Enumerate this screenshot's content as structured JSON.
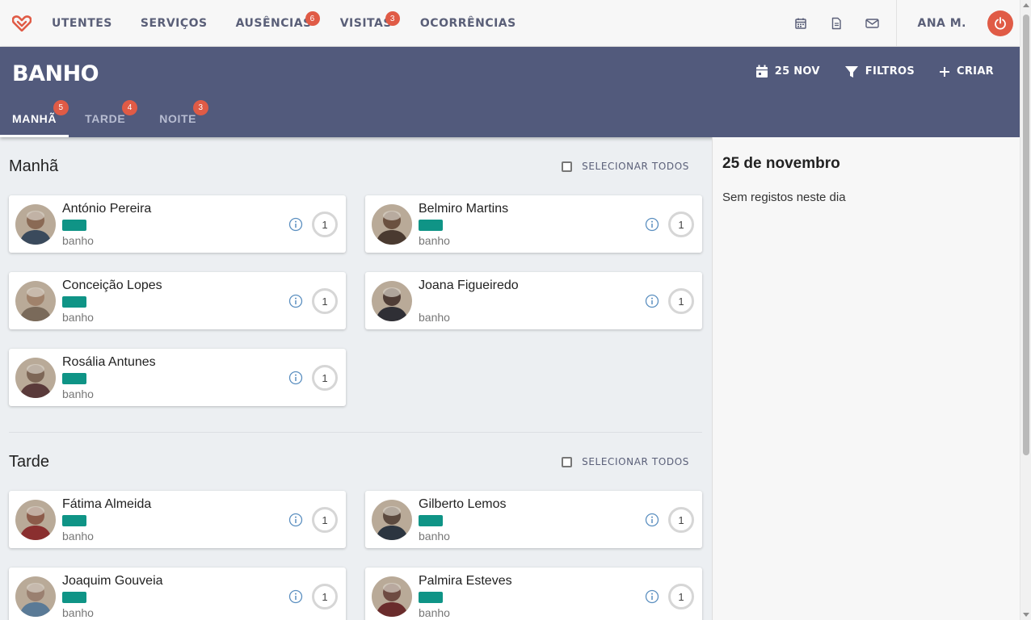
{
  "nav": {
    "logo": "heart-logo",
    "items": [
      {
        "label": "UTENTES",
        "badge": null
      },
      {
        "label": "SERVIÇOS",
        "badge": null
      },
      {
        "label": "AUSÊNCIAS",
        "badge": "6"
      },
      {
        "label": "VISITAS",
        "badge": "3"
      },
      {
        "label": "OCORRÊNCIAS",
        "badge": null
      }
    ],
    "icons": [
      "calendar-icon",
      "document-icon",
      "mail-icon"
    ],
    "user": "ANA M.",
    "power_icon": "power-icon"
  },
  "header": {
    "title": "BANHO",
    "date_label": "25 NOV",
    "filters_label": "FILTROS",
    "create_label": "CRIAR"
  },
  "tabs": [
    {
      "label": "MANHÃ",
      "badge": "5",
      "active": true
    },
    {
      "label": "TARDE",
      "badge": "4",
      "active": false
    },
    {
      "label": "NOITE",
      "badge": "3",
      "active": false
    }
  ],
  "sections": [
    {
      "title": "Manhã",
      "select_all": "SELECIONAR TODOS",
      "cards": [
        {
          "name": "António Pereira",
          "sub": "banho",
          "count": "1",
          "tag": true
        },
        {
          "name": "Belmiro Martins",
          "sub": "banho",
          "count": "1",
          "tag": true
        },
        {
          "name": "Conceição Lopes",
          "sub": "banho",
          "count": "1",
          "tag": true
        },
        {
          "name": "Joana Figueiredo",
          "sub": "banho",
          "count": "1",
          "tag": false
        },
        {
          "name": "Rosália Antunes",
          "sub": "banho",
          "count": "1",
          "tag": true
        }
      ]
    },
    {
      "title": "Tarde",
      "select_all": "SELECIONAR TODOS",
      "cards": [
        {
          "name": "Fátima Almeida",
          "sub": "banho",
          "count": "1",
          "tag": true
        },
        {
          "name": "Gilberto Lemos",
          "sub": "banho",
          "count": "1",
          "tag": true
        },
        {
          "name": "Joaquim Gouveia",
          "sub": "banho",
          "count": "1",
          "tag": true
        },
        {
          "name": "Palmira Esteves",
          "sub": "banho",
          "count": "1",
          "tag": true
        }
      ]
    }
  ],
  "right_panel": {
    "date": "25 de novembro",
    "empty_text": "Sem registos neste dia"
  },
  "colors": {
    "accent": "#e05b46",
    "header_bg": "#525a7c",
    "tag": "#0f9486",
    "nav_text": "#5a5f78"
  }
}
